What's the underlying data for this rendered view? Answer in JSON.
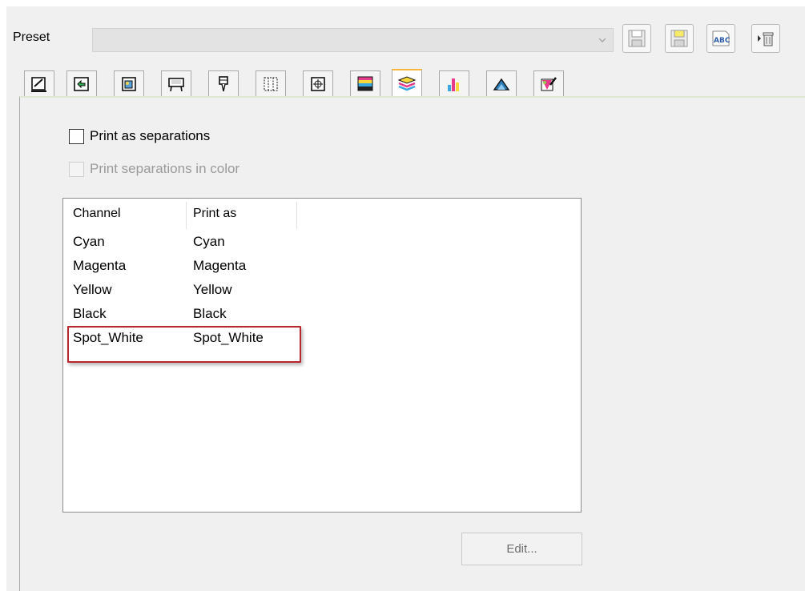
{
  "preset": {
    "label": "Preset",
    "value": "",
    "toolbar": [
      "save-icon",
      "save-as-icon",
      "rename-abc-icon",
      "delete-icon"
    ]
  },
  "tabs": [
    {
      "icon": "page-setup-icon",
      "active": false
    },
    {
      "icon": "transform-icon",
      "active": false
    },
    {
      "icon": "image-quality-icon",
      "active": false
    },
    {
      "icon": "printer-icon",
      "active": false
    },
    {
      "icon": "cutter-icon",
      "active": false
    },
    {
      "icon": "tiling-icon",
      "active": false
    },
    {
      "icon": "marks-icon",
      "active": false
    },
    {
      "icon": "color-layers-icon",
      "active": false
    },
    {
      "icon": "separations-icon",
      "active": true
    },
    {
      "icon": "color-bars-icon",
      "active": false
    },
    {
      "icon": "ink-drop-icon",
      "active": false
    },
    {
      "icon": "color-edit-icon",
      "active": false
    }
  ],
  "options": {
    "print_as_separations": {
      "label": "Print as separations",
      "checked": false,
      "enabled": true
    },
    "print_separations_in_color": {
      "label": "Print separations in color",
      "checked": false,
      "enabled": false
    }
  },
  "channels": {
    "headers": [
      "Channel",
      "Print as"
    ],
    "rows": [
      {
        "channel": "Cyan",
        "print_as": "Cyan"
      },
      {
        "channel": "Magenta",
        "print_as": "Magenta"
      },
      {
        "channel": "Yellow",
        "print_as": "Yellow"
      },
      {
        "channel": "Black",
        "print_as": "Black"
      },
      {
        "channel": "Spot_White",
        "print_as": "Spot_White"
      }
    ]
  },
  "edit_button": "Edit...",
  "colors": {
    "highlight": "#b8262e",
    "active_tab": "#f6b73c"
  }
}
